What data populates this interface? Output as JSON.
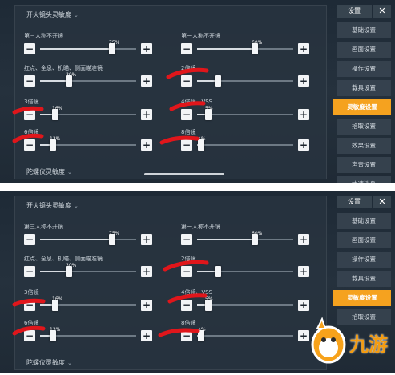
{
  "screens": [
    {
      "section_scope": "开火镜头灵敏度",
      "section_gyro": "陀螺仪灵敏度",
      "controls": [
        {
          "label": "第三人称不开镜",
          "value": "75%",
          "level": 0.75
        },
        {
          "label": "第一人称不开镜",
          "value": "60%",
          "level": 0.6
        },
        {
          "label": "红点、全息、机瞄、侧面瞄准镜",
          "value": "30%",
          "level": 0.3
        },
        {
          "label": "2倍镜",
          "value": "",
          "level": 0.22
        },
        {
          "label": "3倍镜",
          "value": "16%",
          "level": 0.16
        },
        {
          "label": "4倍镜、VSS",
          "value": "5%",
          "level": 0.12
        },
        {
          "label": "6倍镜",
          "value": "13%",
          "level": 0.13
        },
        {
          "label": "8倍镜",
          "value": "4%",
          "level": 0.04
        }
      ]
    },
    {
      "section_scope": "开火镜头灵敏度",
      "section_gyro": "陀螺仪灵敏度",
      "controls": [
        {
          "label": "第三人称不开镜",
          "value": "75%",
          "level": 0.75
        },
        {
          "label": "第一人称不开镜",
          "value": "60%",
          "level": 0.6
        },
        {
          "label": "红点、全息、机瞄、侧面瞄准镜",
          "value": "30%",
          "level": 0.3
        },
        {
          "label": "2倍镜",
          "value": "",
          "level": 0.22
        },
        {
          "label": "3倍镜",
          "value": "16%",
          "level": 0.16
        },
        {
          "label": "4倍镜、VSS",
          "value": "5%",
          "level": 0.12
        },
        {
          "label": "6倍镜",
          "value": "13%",
          "level": 0.13
        },
        {
          "label": "8倍镜",
          "value": "4%",
          "level": 0.04
        }
      ]
    }
  ],
  "sidebar": {
    "title": "设置",
    "close": "✕",
    "items_top": [
      "基础设置",
      "画面设置",
      "操作设置",
      "载具设置",
      "灵敏度设置",
      "拾取设置",
      "效果设置",
      "声音设置",
      "快速消息"
    ],
    "items_bottom": [
      "基础设置",
      "画面设置",
      "操作设置",
      "载具设置",
      "灵敏度设置",
      "拾取设置"
    ],
    "active_label": "灵敏度设置"
  },
  "buttons": {
    "minus": "−",
    "plus": "+"
  },
  "watermark": {
    "text": "九游"
  },
  "colors": {
    "accent": "#f5a21f",
    "redact": "#e0161b",
    "panel": "#283440"
  }
}
